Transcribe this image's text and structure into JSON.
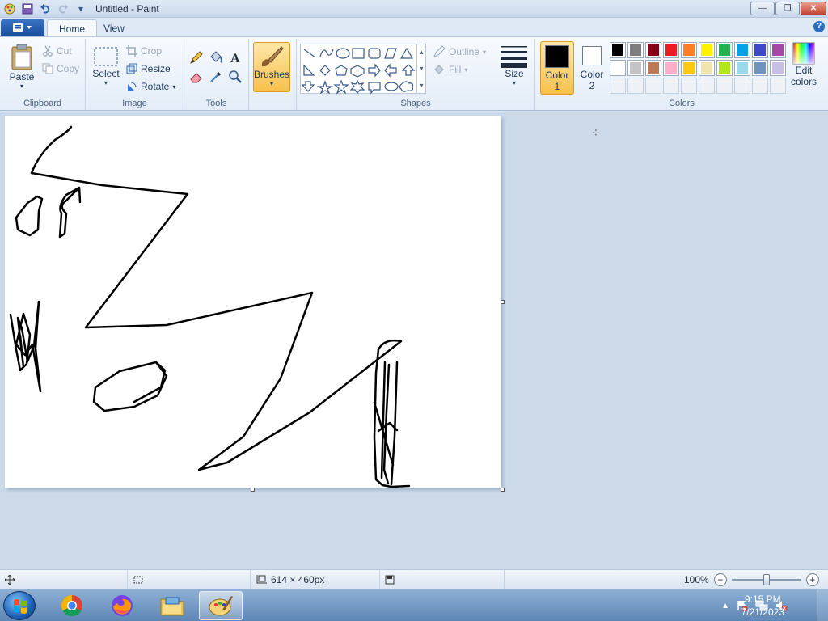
{
  "window": {
    "title": "Untitled - Paint",
    "controls": {
      "minimize": "—",
      "restore": "❐",
      "close": "✕"
    }
  },
  "tabs": [
    {
      "label": "Home",
      "active": true
    },
    {
      "label": "View",
      "active": false
    }
  ],
  "ribbon": {
    "clipboard": {
      "group_label": "Clipboard",
      "paste": "Paste",
      "cut": "Cut",
      "copy": "Copy"
    },
    "image": {
      "group_label": "Image",
      "select": "Select",
      "crop": "Crop",
      "resize": "Resize",
      "rotate": "Rotate"
    },
    "tools": {
      "group_label": "Tools"
    },
    "brushes": {
      "label": "Brushes"
    },
    "shapes": {
      "group_label": "Shapes",
      "outline": "Outline",
      "fill": "Fill"
    },
    "size": {
      "label": "Size"
    },
    "color1": {
      "label_line1": "Color",
      "label_line2": "1",
      "value": "#000000"
    },
    "color2": {
      "label_line1": "Color",
      "label_line2": "2",
      "value": "#ffffff"
    },
    "colors": {
      "group_label": "Colors",
      "edit_label_line1": "Edit",
      "edit_label_line2": "colors",
      "palette_row1": [
        "#000000",
        "#7f7f7f",
        "#880015",
        "#ed1c24",
        "#ff7f27",
        "#fff200",
        "#22b14c",
        "#00a2e8",
        "#3f48cc",
        "#a349a4"
      ],
      "palette_row2": [
        "#ffffff",
        "#c3c3c3",
        "#b97a57",
        "#ffaec9",
        "#ffc90e",
        "#efe4b0",
        "#b5e61d",
        "#99d9ea",
        "#7092be",
        "#c8bfe7"
      ]
    }
  },
  "statusbar": {
    "image_size": "614 × 460px",
    "zoom": "100%",
    "zoom_level": 0.5
  },
  "taskbar": {
    "apps": [
      "chrome-icon",
      "firefox-icon",
      "file-explorer-icon",
      "paint-icon"
    ],
    "time": "9:15 PM",
    "date": "7/21/2023"
  }
}
